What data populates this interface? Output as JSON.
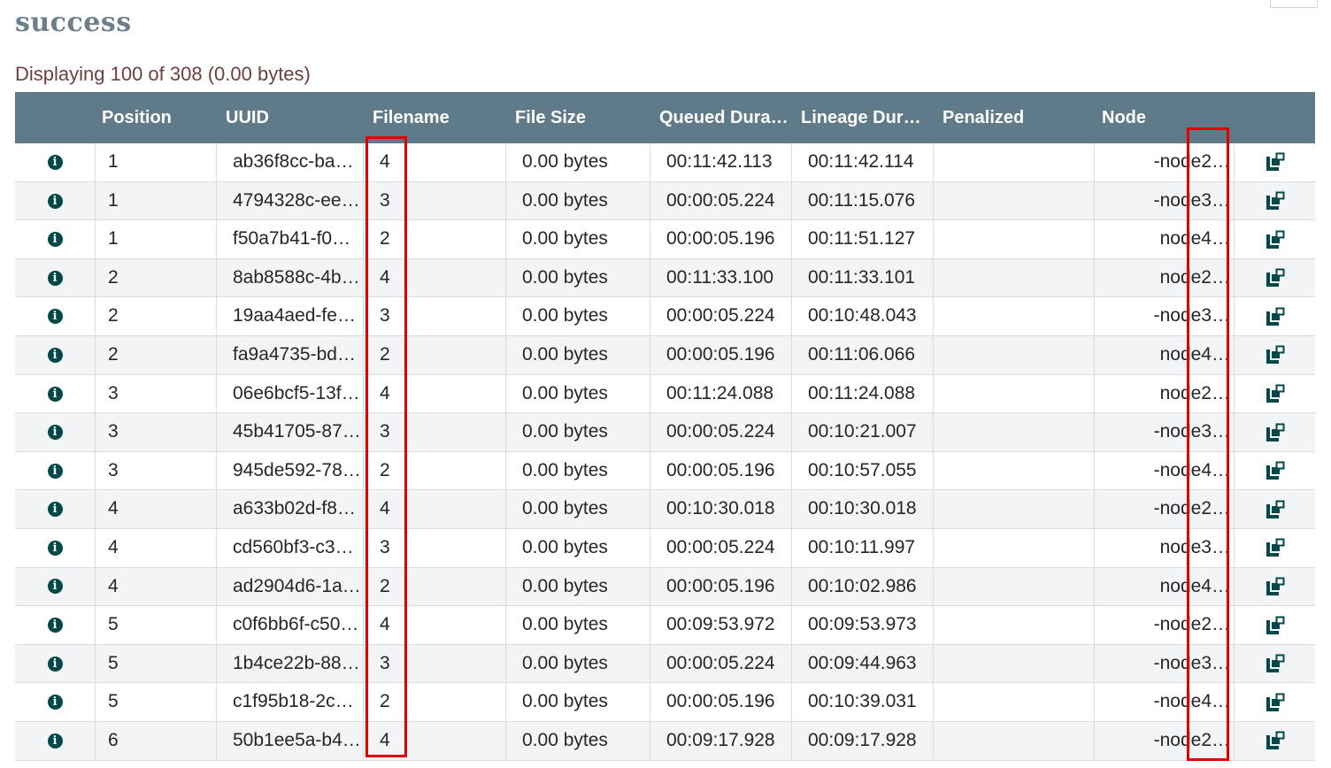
{
  "title": "success",
  "summary": "Displaying 100 of 308 (0.00 bytes)",
  "columns": {
    "position": "Position",
    "uuid": "UUID",
    "filename": "Filename",
    "file_size": "File Size",
    "queued_duration": "Queued Dura…",
    "lineage_duration": "Lineage Dur…",
    "penalized": "Penalized",
    "node": "Node"
  },
  "icons": {
    "info": "info-circle-icon",
    "provenance": "provenance-icon"
  },
  "colors": {
    "header_bg": "#5f7b8a",
    "icon": "#004849",
    "highlight": "#e30000",
    "summary": "#6e3f3f"
  },
  "rows": [
    {
      "position": "1",
      "uuid": "ab36f8cc-ba…",
      "filename": "4",
      "size": "0.00 bytes",
      "queued": "00:11:42.113",
      "lineage": "00:11:42.114",
      "penalized": "",
      "node": "-node2…"
    },
    {
      "position": "1",
      "uuid": "4794328c-ee…",
      "filename": "3",
      "size": "0.00 bytes",
      "queued": "00:00:05.224",
      "lineage": "00:11:15.076",
      "penalized": "",
      "node": "-node3…"
    },
    {
      "position": "1",
      "uuid": "f50a7b41-f0…",
      "filename": "2",
      "size": "0.00 bytes",
      "queued": "00:00:05.196",
      "lineage": "00:11:51.127",
      "penalized": "",
      "node": "node4…"
    },
    {
      "position": "2",
      "uuid": "8ab8588c-4b…",
      "filename": "4",
      "size": "0.00 bytes",
      "queued": "00:11:33.100",
      "lineage": "00:11:33.101",
      "penalized": "",
      "node": "node2…"
    },
    {
      "position": "2",
      "uuid": "19aa4aed-fe…",
      "filename": "3",
      "size": "0.00 bytes",
      "queued": "00:00:05.224",
      "lineage": "00:10:48.043",
      "penalized": "",
      "node": "-node3…"
    },
    {
      "position": "2",
      "uuid": "fa9a4735-bd…",
      "filename": "2",
      "size": "0.00 bytes",
      "queued": "00:00:05.196",
      "lineage": "00:11:06.066",
      "penalized": "",
      "node": "node4…"
    },
    {
      "position": "3",
      "uuid": "06e6bcf5-13f…",
      "filename": "4",
      "size": "0.00 bytes",
      "queued": "00:11:24.088",
      "lineage": "00:11:24.088",
      "penalized": "",
      "node": "node2…"
    },
    {
      "position": "3",
      "uuid": "45b41705-87…",
      "filename": "3",
      "size": "0.00 bytes",
      "queued": "00:00:05.224",
      "lineage": "00:10:21.007",
      "penalized": "",
      "node": "-node3…"
    },
    {
      "position": "3",
      "uuid": "945de592-78…",
      "filename": "2",
      "size": "0.00 bytes",
      "queued": "00:00:05.196",
      "lineage": "00:10:57.055",
      "penalized": "",
      "node": "-node4…"
    },
    {
      "position": "4",
      "uuid": "a633b02d-f8…",
      "filename": "4",
      "size": "0.00 bytes",
      "queued": "00:10:30.018",
      "lineage": "00:10:30.018",
      "penalized": "",
      "node": "-node2…"
    },
    {
      "position": "4",
      "uuid": "cd560bf3-c3…",
      "filename": "3",
      "size": "0.00 bytes",
      "queued": "00:00:05.224",
      "lineage": "00:10:11.997",
      "penalized": "",
      "node": "node3…"
    },
    {
      "position": "4",
      "uuid": "ad2904d6-1a…",
      "filename": "2",
      "size": "0.00 bytes",
      "queued": "00:00:05.196",
      "lineage": "00:10:02.986",
      "penalized": "",
      "node": "node4…"
    },
    {
      "position": "5",
      "uuid": "c0f6bb6f-c50…",
      "filename": "4",
      "size": "0.00 bytes",
      "queued": "00:09:53.972",
      "lineage": "00:09:53.973",
      "penalized": "",
      "node": "-node2…"
    },
    {
      "position": "5",
      "uuid": "1b4ce22b-88…",
      "filename": "3",
      "size": "0.00 bytes",
      "queued": "00:00:05.224",
      "lineage": "00:09:44.963",
      "penalized": "",
      "node": "-node3…"
    },
    {
      "position": "5",
      "uuid": "c1f95b18-2c…",
      "filename": "2",
      "size": "0.00 bytes",
      "queued": "00:00:05.196",
      "lineage": "00:10:39.031",
      "penalized": "",
      "node": "-node4…"
    },
    {
      "position": "6",
      "uuid": "50b1ee5a-b4…",
      "filename": "4",
      "size": "0.00 bytes",
      "queued": "00:09:17.928",
      "lineage": "00:09:17.928",
      "penalized": "",
      "node": "-node2…"
    }
  ]
}
